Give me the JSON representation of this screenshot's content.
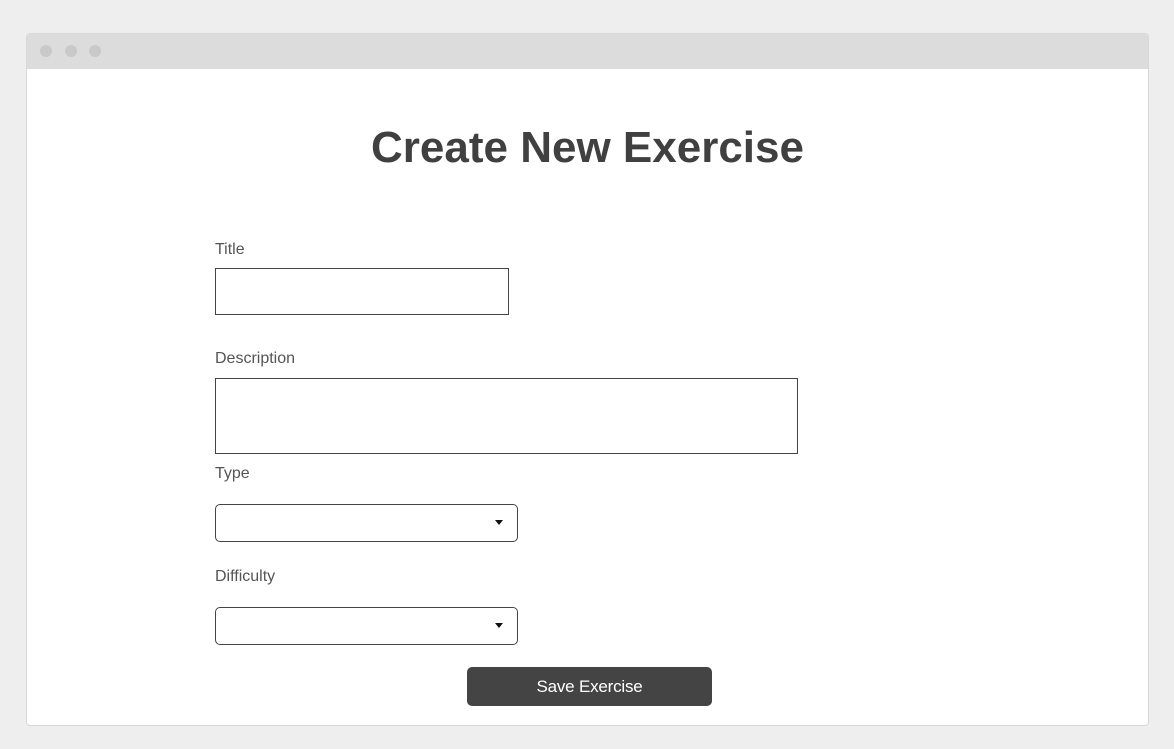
{
  "page": {
    "title": "Create New Exercise"
  },
  "form": {
    "title_field": {
      "label": "Title",
      "value": "",
      "placeholder": ""
    },
    "description_field": {
      "label": "Description",
      "value": "",
      "placeholder": ""
    },
    "type_field": {
      "label": "Type",
      "selected": ""
    },
    "difficulty_field": {
      "label": "Difficulty",
      "selected": ""
    },
    "save_label": "Save Exercise"
  },
  "icons": {
    "dropdown": "caret-down-icon",
    "window_dots": "window-control-dot-icon"
  },
  "colors": {
    "button_background": "#444444",
    "title_text": "#404040",
    "page_background": "#eeeeee",
    "window_background": "#ffffff",
    "titlebar_background": "#dcdcdc"
  }
}
